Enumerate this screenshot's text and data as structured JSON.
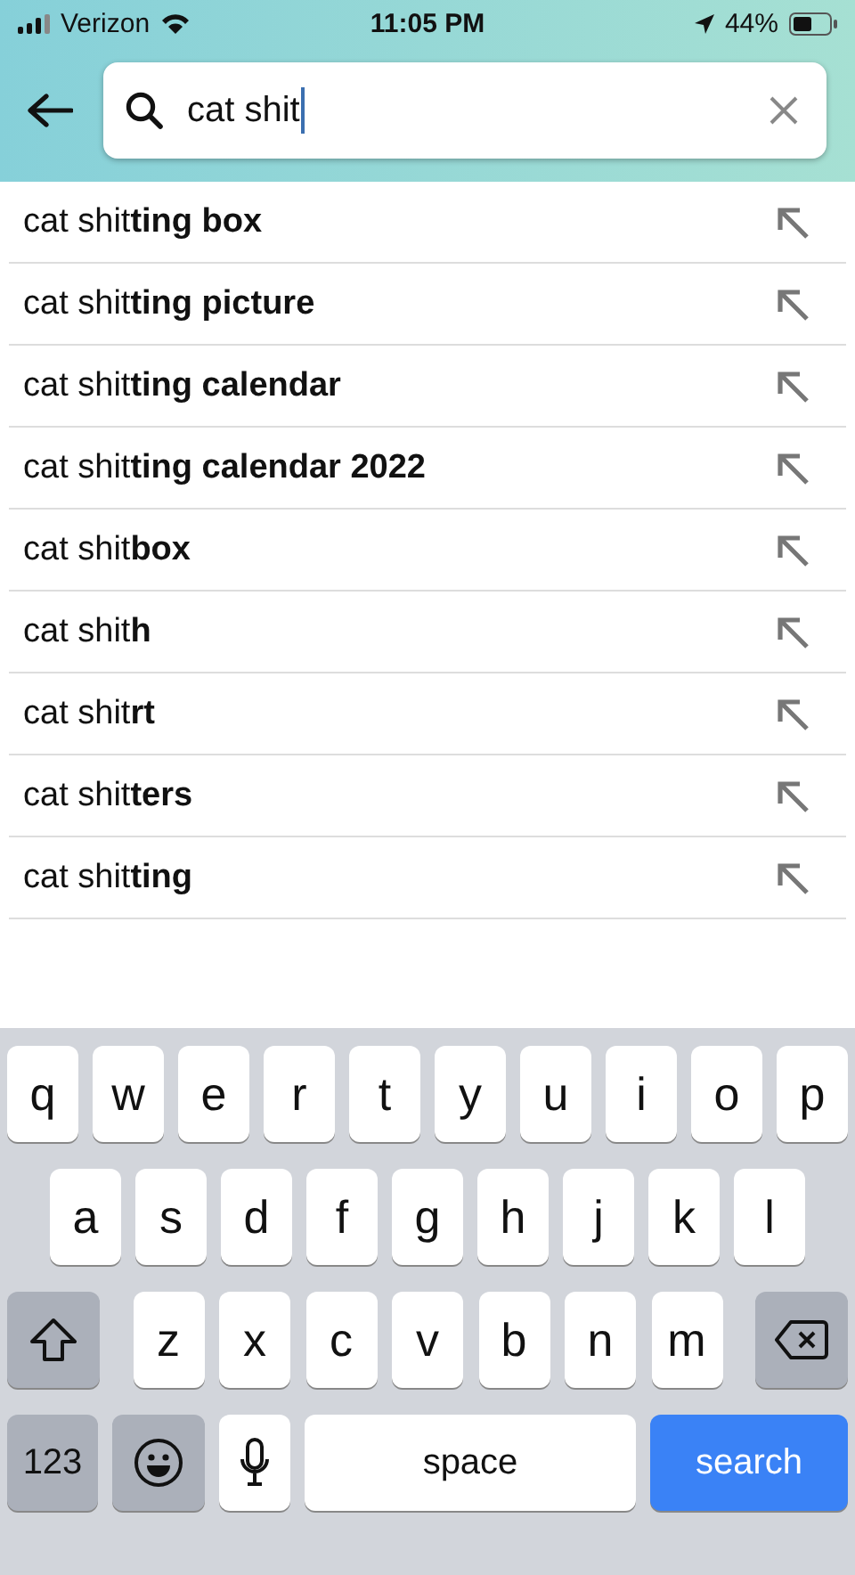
{
  "status_bar": {
    "carrier": "Verizon",
    "time": "11:05 PM",
    "battery": "44%"
  },
  "search": {
    "value": "cat shit"
  },
  "suggestions": [
    {
      "text": "cat shit**ting box**"
    },
    {
      "text": "cat shit**ting picture**"
    },
    {
      "text": "cat shit**ting calendar**"
    },
    {
      "text": "cat shit**ting calendar 2022**"
    },
    {
      "text": "cat shit**box**"
    },
    {
      "text": "cat shit**h**"
    },
    {
      "text": "cat shit**rt**"
    },
    {
      "text": "cat shit**ters**"
    },
    {
      "text": "cat shit**ting**"
    }
  ],
  "keyboard": [
    [
      {
        "kind": "letter",
        "label": "q"
      },
      {
        "kind": "letter",
        "label": "w"
      },
      {
        "kind": "letter",
        "label": "e"
      },
      {
        "kind": "letter",
        "label": "r"
      },
      {
        "kind": "letter",
        "label": "t"
      },
      {
        "kind": "letter",
        "label": "y"
      },
      {
        "kind": "letter",
        "label": "u"
      },
      {
        "kind": "letter",
        "label": "i"
      },
      {
        "kind": "letter",
        "label": "o"
      },
      {
        "kind": "letter",
        "label": "p"
      }
    ],
    [
      {
        "kind": "letter",
        "label": "a"
      },
      {
        "kind": "letter",
        "label": "s"
      },
      {
        "kind": "letter",
        "label": "d"
      },
      {
        "kind": "letter",
        "label": "f"
      },
      {
        "kind": "letter",
        "label": "g"
      },
      {
        "kind": "letter",
        "label": "h"
      },
      {
        "kind": "letter",
        "label": "j"
      },
      {
        "kind": "letter",
        "label": "k"
      },
      {
        "kind": "letter",
        "label": "l"
      }
    ],
    [
      {
        "kind": "shift"
      },
      {
        "kind": "letter",
        "label": "z"
      },
      {
        "kind": "letter",
        "label": "x"
      },
      {
        "kind": "letter",
        "label": "c"
      },
      {
        "kind": "letter",
        "label": "v"
      },
      {
        "kind": "letter",
        "label": "b"
      },
      {
        "kind": "letter",
        "label": "n"
      },
      {
        "kind": "letter",
        "label": "m"
      },
      {
        "kind": "backspace"
      }
    ],
    [
      {
        "kind": "numbers",
        "label": "123"
      },
      {
        "kind": "emoji"
      },
      {
        "kind": "mic"
      },
      {
        "kind": "space",
        "label": "space"
      },
      {
        "kind": "search",
        "label": "search"
      }
    ]
  ]
}
